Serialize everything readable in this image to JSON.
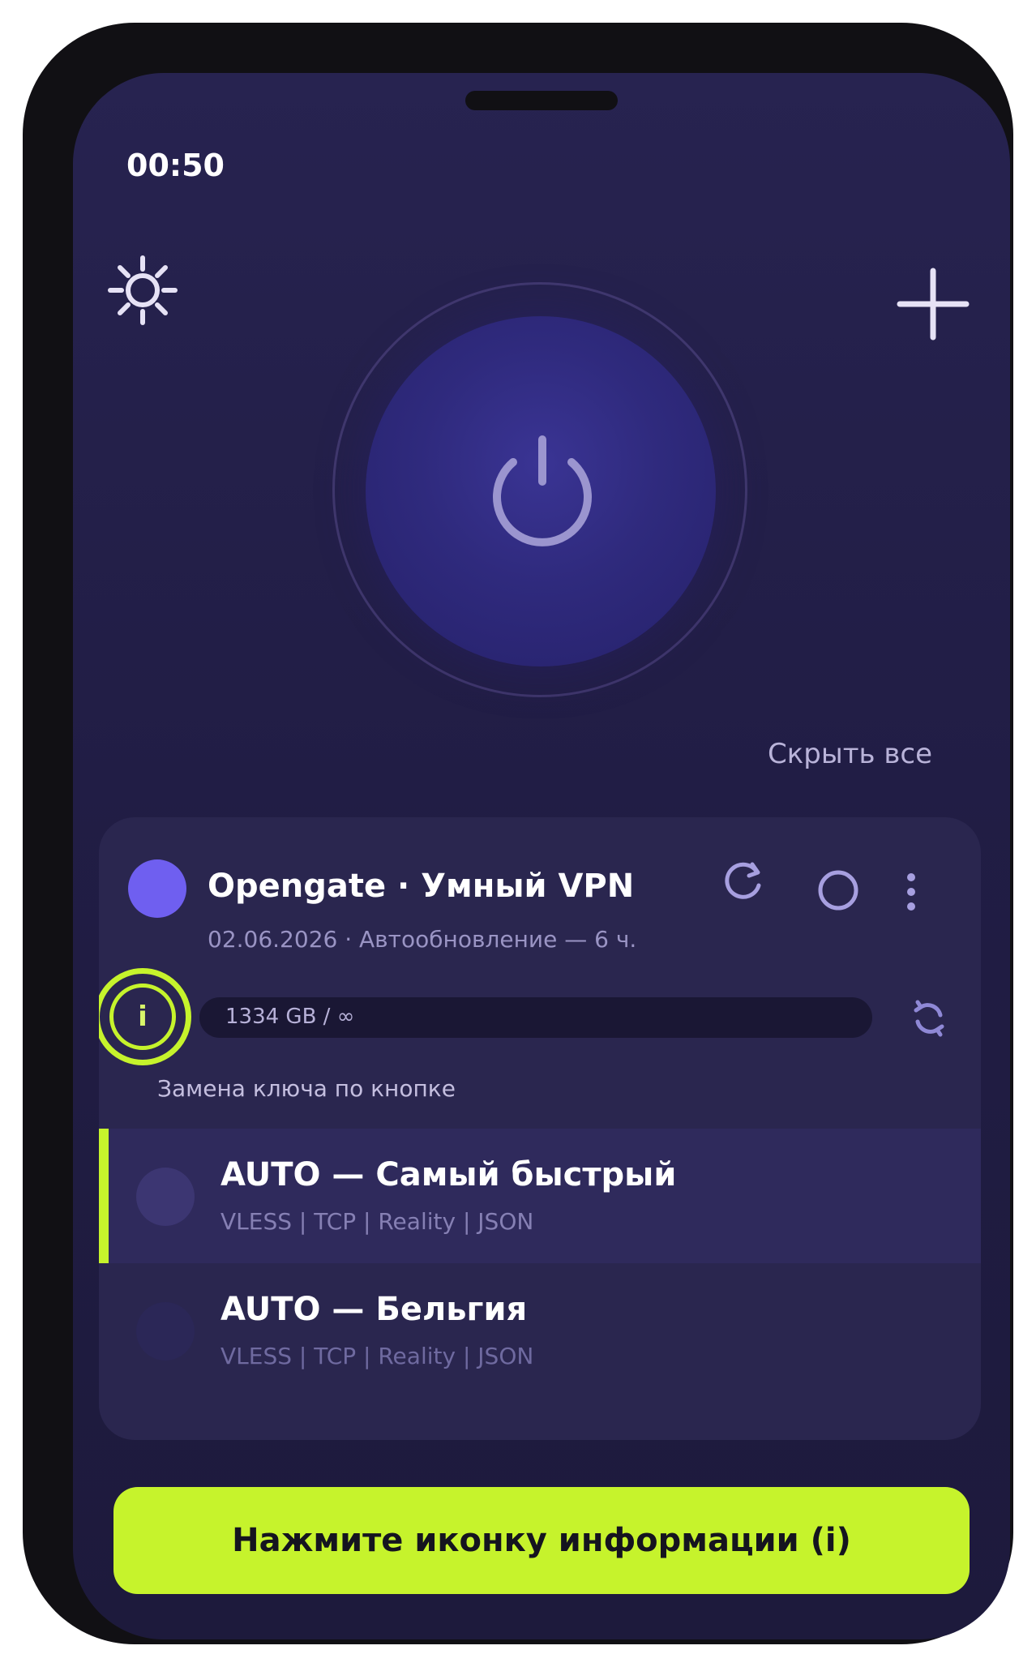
{
  "status_bar": {
    "time": "00:50"
  },
  "header": {
    "settings_icon": "gear-icon",
    "add_icon": "plus-icon"
  },
  "power": {
    "icon": "power-icon",
    "state": "disconnected"
  },
  "list_controls": {
    "hide_all": "Скрыть все"
  },
  "subscription": {
    "name": "Opengate · Умный VPN",
    "meta": "02.06.2026 · Автообновление — 6 ч.",
    "traffic": "1334 GB / ∞",
    "key_note": "Замена ключа по кнопке",
    "dot_color": "#6f5ff0"
  },
  "servers": [
    {
      "title": "AUTO — Самый быстрый",
      "subtitle": "VLESS | TCP | Reality | JSON",
      "selected": true
    },
    {
      "title": "AUTO — Бельгия",
      "subtitle": "VLESS | TCP | Reality | JSON",
      "selected": false
    }
  ],
  "cta": {
    "label": "Нажмите иконку информации (i)"
  },
  "colors": {
    "accent": "#c6f32c",
    "background": "#241f4a",
    "card": "#2a264f"
  }
}
